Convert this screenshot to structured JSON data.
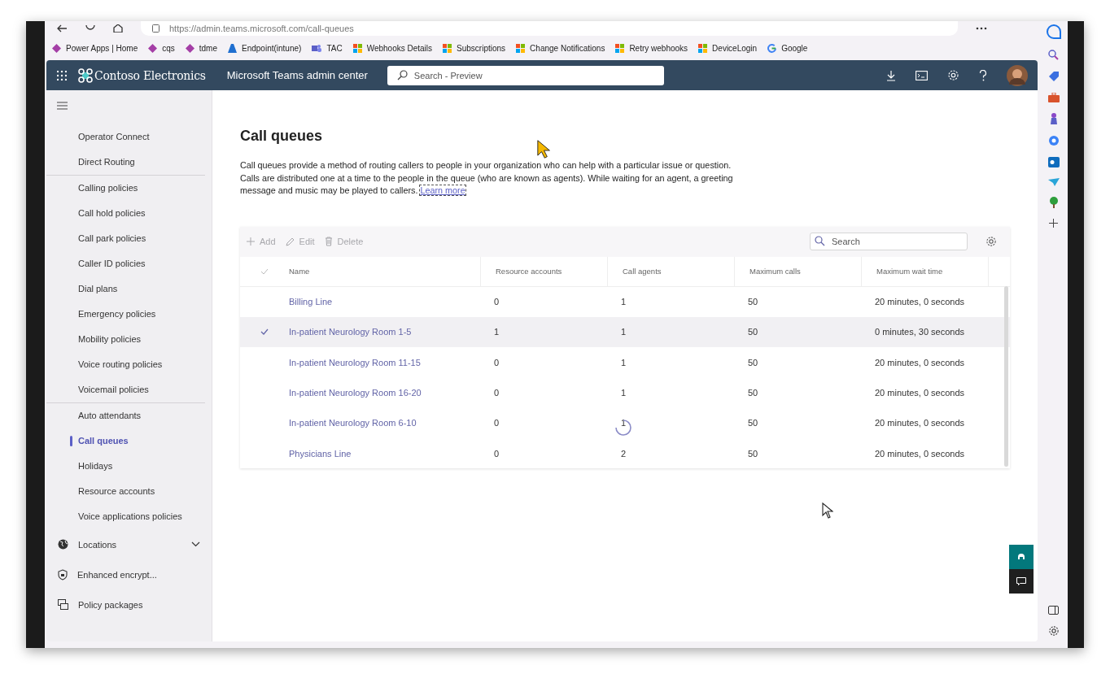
{
  "browser": {
    "url": "https://admin.teams.microsoft.com/call-queues",
    "bookmarks": [
      {
        "label": "Power Apps | Home",
        "kind": "powerapps"
      },
      {
        "label": "cqs",
        "kind": "powerapps"
      },
      {
        "label": "tdme",
        "kind": "powerapps"
      },
      {
        "label": "Endpoint(intune)",
        "kind": "azure"
      },
      {
        "label": "TAC",
        "kind": "teams"
      },
      {
        "label": "Webhooks Details",
        "kind": "microsoft"
      },
      {
        "label": "Subscriptions",
        "kind": "microsoft"
      },
      {
        "label": "Change Notifications",
        "kind": "microsoft"
      },
      {
        "label": "Retry webhooks",
        "kind": "microsoft"
      },
      {
        "label": "DeviceLogin",
        "kind": "microsoft"
      },
      {
        "label": "Google",
        "kind": "google"
      }
    ]
  },
  "header": {
    "brand": "Contoso Electronics",
    "app_title": "Microsoft Teams admin center",
    "search": {
      "placeholder": "Search - Preview"
    }
  },
  "sidebar": {
    "groups": [
      {
        "items": [
          {
            "label": "Operator Connect",
            "selected": false
          },
          {
            "label": "Direct Routing",
            "selected": false
          }
        ]
      },
      {
        "items": [
          {
            "label": "Calling policies",
            "selected": false
          },
          {
            "label": "Call hold policies",
            "selected": false
          },
          {
            "label": "Call park policies",
            "selected": false
          },
          {
            "label": "Caller ID policies",
            "selected": false
          },
          {
            "label": "Dial plans",
            "selected": false
          },
          {
            "label": "Emergency policies",
            "selected": false
          },
          {
            "label": "Mobility policies",
            "selected": false
          },
          {
            "label": "Voice routing policies",
            "selected": false
          },
          {
            "label": "Voicemail policies",
            "selected": false
          }
        ]
      },
      {
        "items": [
          {
            "label": "Auto attendants",
            "selected": false
          },
          {
            "label": "Call queues",
            "selected": true
          },
          {
            "label": "Holidays",
            "selected": false
          },
          {
            "label": "Resource accounts",
            "selected": false
          },
          {
            "label": "Voice applications policies",
            "selected": false
          }
        ]
      }
    ],
    "nav": [
      {
        "label": "Locations",
        "kind": "globe",
        "expanded": false
      },
      {
        "label": "Enhanced encrypt...",
        "kind": "shield"
      },
      {
        "label": "Policy packages",
        "kind": "package"
      }
    ]
  },
  "page": {
    "title": "Call queues",
    "description": "Call queues provide a method of routing callers to people in your organization who can help with a particular issue or question. Calls are distributed one at a time to the people in the queue (who are known as agents). While waiting for an agent, a greeting message and music may be played to callers.",
    "learn_more": "Learn more",
    "actions": [
      {
        "label": "Add",
        "kind": "add",
        "disabled": true
      },
      {
        "label": "Edit",
        "kind": "edit",
        "disabled": true
      },
      {
        "label": "Delete",
        "kind": "delete",
        "disabled": true
      }
    ],
    "search": {
      "placeholder": "Search"
    },
    "table": {
      "columns": [
        "Name",
        "Resource accounts",
        "Call agents",
        "Maximum calls",
        "Maximum wait time"
      ],
      "rows": [
        {
          "selected": false,
          "cells": [
            "Billing Line",
            "0",
            "1",
            "50",
            "20 minutes, 0 seconds"
          ]
        },
        {
          "selected": true,
          "cells": [
            "In-patient Neurology Room 1-5",
            "1",
            "1",
            "50",
            "0 minutes, 30 seconds"
          ]
        },
        {
          "selected": false,
          "cells": [
            "In-patient Neurology Room 11-15",
            "0",
            "1",
            "50",
            "20 minutes, 0 seconds"
          ]
        },
        {
          "selected": false,
          "cells": [
            "In-patient Neurology Room 16-20",
            "0",
            "1",
            "50",
            "20 minutes, 0 seconds"
          ]
        },
        {
          "selected": false,
          "cells": [
            "In-patient Neurology Room 6-10",
            "0",
            "1",
            "50",
            "20 minutes, 0 seconds"
          ]
        },
        {
          "selected": false,
          "cells": [
            "Physicians Line",
            "0",
            "2",
            "50",
            "20 minutes, 0 seconds"
          ]
        }
      ]
    }
  }
}
